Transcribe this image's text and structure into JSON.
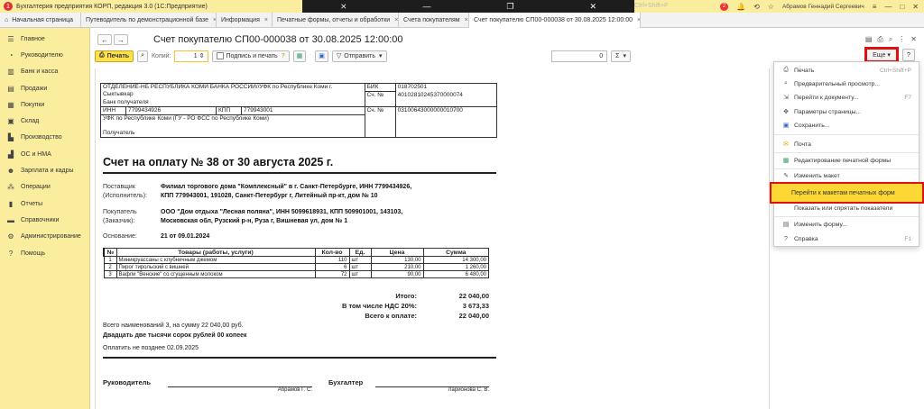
{
  "window": {
    "title": "Бухгалтерия предприятия КОРП, редакция 3.0  (1С:Предприятие)",
    "ghost_shortcut": "Ctrl+Shift+F",
    "notification_count": "2",
    "user": "Абрамов Геннадий Сергеевич"
  },
  "tabs": [
    {
      "label": "Начальная страница"
    },
    {
      "label": "Путеводитель по демонстрационной базе"
    },
    {
      "label": "Информация"
    },
    {
      "label": "Печатные формы, отчеты и обработки"
    },
    {
      "label": "Счета покупателям"
    },
    {
      "label": "Счет покупателю СП00-000038 от 30.08.2025 12:00:00"
    }
  ],
  "sidebar": {
    "items": [
      {
        "label": "Главное",
        "icon": "menu-icon"
      },
      {
        "label": "Руководителю",
        "icon": "chart-icon"
      },
      {
        "label": "Банк и касса",
        "icon": "bank-icon"
      },
      {
        "label": "Продажи",
        "icon": "cart-icon"
      },
      {
        "label": "Покупки",
        "icon": "basket-icon"
      },
      {
        "label": "Склад",
        "icon": "box-icon"
      },
      {
        "label": "Производство",
        "icon": "factory-icon"
      },
      {
        "label": "ОС и НМА",
        "icon": "building-icon"
      },
      {
        "label": "Зарплата и кадры",
        "icon": "people-icon"
      },
      {
        "label": "Операции",
        "icon": "operations-icon"
      },
      {
        "label": "Отчеты",
        "icon": "report-icon"
      },
      {
        "label": "Справочники",
        "icon": "book-icon"
      },
      {
        "label": "Администрирование",
        "icon": "settings-icon"
      },
      {
        "label": "Помощь",
        "icon": "help-icon"
      }
    ]
  },
  "header": {
    "title": "Счет покупателю СП00-000038 от 30.08.2025 12:00:00"
  },
  "toolbar": {
    "print_label": "Печать",
    "copies_label": "Копий:",
    "copies_value": "1",
    "sign_label": "Подпись и печать",
    "send_label": "Отправить",
    "sum_value": "0",
    "sum_symbol": "Σ",
    "more_label": "Еще",
    "help_label": "?"
  },
  "bank": {
    "bank_name": "ОТДЕЛЕНИЕ-НБ РЕСПУБЛИКА КОМИ БАНКА РОССИИ//УФК по Республике Коми г. Сыктывкар",
    "bank_caption": "Банк получателя",
    "bik_label": "БИК",
    "bik_value": "018702501",
    "acc_label": "Сч. №",
    "corr_value": "40102810245370000074",
    "inn_label": "ИНН",
    "inn_value": "7799434926",
    "kpp_label": "КПП",
    "kpp_value": "779943001",
    "acc_value": "03100643000000010700",
    "recipient_name": "УФК по Республике Коми (ГУ - РО ФСС по Республике Коми)",
    "recipient_caption": "Получатель"
  },
  "invoice": {
    "title": "Счет на оплату № 38 от 30 августа 2025 г.",
    "supplier_label_1": "Поставщик",
    "supplier_label_2": "(Исполнитель):",
    "supplier_line_1": "Филиал торгового дома \"Комплексный\" в г. Санкт-Петербурге, ИНН 7799434926,",
    "supplier_line_2": "КПП 779943001, 191028, Санкт-Петербург г, Литейный пр-кт, дом № 10",
    "buyer_label_1": "Покупатель",
    "buyer_label_2": "(Заказчик):",
    "buyer_line_1": "ООО \"Дом отдыха \"Лесная поляна\", ИНН 5099618931, КПП 509901001, 143103,",
    "buyer_line_2": "Московская обл, Рузский р-н, Руза г, Вишневая ул, дом № 1",
    "basis_label": "Основание:",
    "basis_value": "21 от 09.01.2024",
    "columns": [
      "№",
      "Товары (работы, услуги)",
      "Кол-во",
      "Ед.",
      "Цена",
      "Сумма"
    ],
    "rows": [
      {
        "n": "1",
        "name": "Миникруассаны с клубничным джемом",
        "qty": "110",
        "unit": "шт",
        "price": "130,00",
        "sum": "14 300,00"
      },
      {
        "n": "2",
        "name": "Пирог тирольский с вишней",
        "qty": "6",
        "unit": "шт",
        "price": "210,00",
        "sum": "1 260,00"
      },
      {
        "n": "3",
        "name": "Вафли \"Венские\" со сгущенным молоком",
        "qty": "72",
        "unit": "шт",
        "price": "90,00",
        "sum": "6 480,00"
      }
    ],
    "total_label": "Итого:",
    "total_value": "22 040,00",
    "vat_label": "В том числе НДС 20%:",
    "vat_value": "3 673,33",
    "pay_label": "Всего к оплате:",
    "pay_value": "22 040,00",
    "summary_line": "Всего наименований 3, на сумму 22 040,00 руб.",
    "amount_words": "Двадцать две тысячи сорок рублей 00 копеек",
    "due_line": "Оплатить не позднее 02.09.2025",
    "head_label": "Руководитель",
    "head_name": "Абрамов Г. С.",
    "accountant_label": "Бухгалтер",
    "accountant_name": "Ларионова С. В."
  },
  "more_menu": {
    "items": [
      {
        "label": "Печать",
        "shortcut": "Ctrl+Shift+P",
        "icon": "printer-icon"
      },
      {
        "label": "Предварительный просмотр...",
        "shortcut": "",
        "icon": "preview-icon"
      },
      {
        "label": "Перейти к документу...",
        "shortcut": "F7",
        "icon": "goto-document-icon"
      },
      {
        "label": "Параметры страницы...",
        "shortcut": "",
        "icon": "page-settings-icon"
      },
      {
        "label": "Сохранить...",
        "shortcut": "",
        "icon": "save-icon"
      },
      {
        "label": "Почта",
        "shortcut": "",
        "icon": "mail-icon"
      },
      {
        "label": "Редактирование печатной формы",
        "shortcut": "",
        "icon": "edit-form-icon"
      },
      {
        "label": "Изменить макет",
        "shortcut": "",
        "icon": "pencil-icon"
      },
      {
        "label": "Перейти к макетам печатных форм",
        "shortcut": "",
        "icon": ""
      },
      {
        "label": "Показать или спрятать показатели",
        "shortcut": "",
        "icon": ""
      },
      {
        "label": "Изменить форму...",
        "shortcut": "",
        "icon": "form-icon"
      },
      {
        "label": "Справка",
        "shortcut": "F1",
        "icon": "help-icon"
      }
    ]
  },
  "colors": {
    "sidebar_bg": "#fbed9e",
    "highlight": "#fdd835",
    "highlight_border": "#d11111",
    "window_overlay": "#1d1d1d"
  }
}
